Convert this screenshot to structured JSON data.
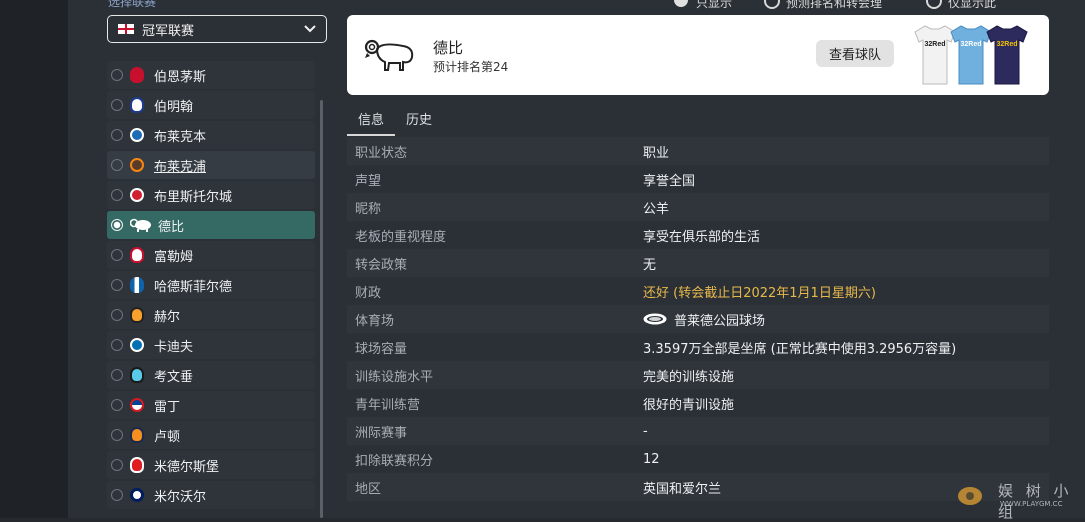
{
  "top": {
    "cut_label": "选择联赛",
    "radio_1": "只显示",
    "radio_2": "预测排名和转会理",
    "radio_3": "仅显示此"
  },
  "league": {
    "selected": "冠军联赛",
    "flag_icon": "england-flag-icon"
  },
  "teams": [
    {
      "name": "伯恩茅斯",
      "color": "#c8102e"
    },
    {
      "name": "伯明翰",
      "color": "#1d3c8f"
    },
    {
      "name": "布莱克本",
      "color": "#1b6bb5"
    },
    {
      "name": "布莱克浦",
      "color": "#f68712"
    },
    {
      "name": "布里斯托尔城",
      "color": "#d01f2e"
    },
    {
      "name": "德比",
      "color": "#ffffff"
    },
    {
      "name": "富勒姆",
      "color": "#ffffff"
    },
    {
      "name": "哈德斯菲尔德",
      "color": "#0e63ad"
    },
    {
      "name": "赫尔",
      "color": "#f5a12c"
    },
    {
      "name": "卡迪夫",
      "color": "#0070b5"
    },
    {
      "name": "考文垂",
      "color": "#59cbe8"
    },
    {
      "name": "雷丁",
      "color": "#004494"
    },
    {
      "name": "卢顿",
      "color": "#f78f1e"
    },
    {
      "name": "米德尔斯堡",
      "color": "#e11b22"
    },
    {
      "name": "米尔沃尔",
      "color": "#001d5e"
    }
  ],
  "club": {
    "name": "德比",
    "predicted_rank": "预计排名第24",
    "view_button": "查看球队",
    "kit_sponsor": "32Red"
  },
  "tabs": [
    {
      "label": "信息"
    },
    {
      "label": "历史"
    }
  ],
  "info": [
    {
      "label": "职业状态",
      "value": "职业"
    },
    {
      "label": "声望",
      "value": "享誉全国"
    },
    {
      "label": "昵称",
      "value": "公羊"
    },
    {
      "label": "老板的重视程度",
      "value": "享受在俱乐部的生活"
    },
    {
      "label": "转会政策",
      "value": "无"
    },
    {
      "label": "财政",
      "value": "还好 (转会截止日2022年1月1日星期六)"
    },
    {
      "label": "体育场",
      "value": "普莱德公园球场"
    },
    {
      "label": "球场容量",
      "value": "3.3597万全部是坐席 (正常比赛中使用3.2956万容量)"
    },
    {
      "label": "训练设施水平",
      "value": "完美的训练设施"
    },
    {
      "label": "青年训练营",
      "value": "很好的青训设施"
    },
    {
      "label": "洲际赛事",
      "value": "-"
    },
    {
      "label": "扣除联赛积分",
      "value": "12"
    },
    {
      "label": "地区",
      "value": "英国和爱尔兰"
    }
  ],
  "colors": {
    "selected_row": "#356a64",
    "warn_text": "#e8b94a",
    "panel_bg": "#2b3036"
  },
  "watermark": {
    "text": "娱 树 小 组",
    "url": "WWW.PLAYGM.CC"
  }
}
